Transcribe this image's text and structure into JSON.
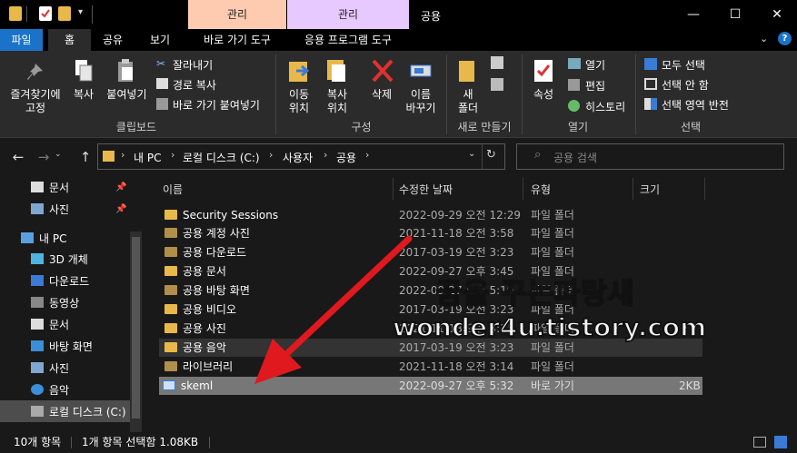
{
  "window": {
    "context_tab_1": "관리",
    "context_tab_2": "관리",
    "title": "공용",
    "ctx1_color": "#ffcbb0",
    "ctx2_color": "#e7c8ff"
  },
  "tabs": {
    "file": "파일",
    "home": "홈",
    "share": "공유",
    "view": "보기",
    "shortcut_tools": "바로 가기 도구",
    "app_tools": "응용 프로그램 도구"
  },
  "ribbon": {
    "pin": "즐겨찾기에\n고정",
    "copy": "복사",
    "paste": "붙여넣기",
    "cut": "잘라내기",
    "copy_path": "경로 복사",
    "paste_shortcut": "바로 가기 붙여넣기",
    "clipboard_group": "클립보드",
    "move_to": "이동\n위치",
    "copy_to": "복사\n위치",
    "delete": "삭제",
    "rename": "이름\n바꾸기",
    "organize_group": "구성",
    "new_folder": "새\n폴더",
    "new_group": "새로 만들기",
    "properties": "속성",
    "open": "열기",
    "edit": "편집",
    "history": "히스토리",
    "open_group": "열기",
    "select_all": "모두 선택",
    "select_none": "선택 안 함",
    "invert": "선택 영역 반전",
    "select_group": "선택"
  },
  "address": {
    "breadcrumb": [
      "내 PC",
      "로컬 디스크 (C:)",
      "사용자",
      "공용"
    ],
    "search_placeholder": "공용 검색"
  },
  "nav": {
    "items": [
      {
        "label": "문서",
        "icon": "documents-icon",
        "pin": true
      },
      {
        "label": "사진",
        "icon": "pictures-icon",
        "pin": true
      },
      {
        "label": "내 PC",
        "icon": "pc-icon"
      },
      {
        "label": "3D 개체",
        "icon": "3d-objects-icon"
      },
      {
        "label": "다운로드",
        "icon": "download-icon"
      },
      {
        "label": "동영상",
        "icon": "videos-icon"
      },
      {
        "label": "문서",
        "icon": "documents-icon"
      },
      {
        "label": "바탕 화면",
        "icon": "desktop-icon"
      },
      {
        "label": "사진",
        "icon": "pictures-icon"
      },
      {
        "label": "음악",
        "icon": "music-icon"
      },
      {
        "label": "로컬 디스크 (C:)",
        "icon": "drive-icon"
      }
    ]
  },
  "columns": {
    "name": "이름",
    "date": "수정한 날짜",
    "type": "유형",
    "size": "크기"
  },
  "files": [
    {
      "name": "Security Sessions",
      "date": "2022-09-29 오전 12:29",
      "type": "파일 폴더",
      "size": ""
    },
    {
      "name": "공용 계정 사진",
      "date": "2021-11-18 오전 3:58",
      "type": "파일 폴더",
      "size": ""
    },
    {
      "name": "공용 다운로드",
      "date": "2017-03-19 오전 3:23",
      "type": "파일 폴더",
      "size": ""
    },
    {
      "name": "공용 문서",
      "date": "2022-09-27 오후 3:45",
      "type": "파일 폴더",
      "size": ""
    },
    {
      "name": "공용 바탕 화면",
      "date": "2022-09-27 오후 5:19",
      "type": "파일 폴더",
      "size": ""
    },
    {
      "name": "공용 비디오",
      "date": "2017-03-19 오전 3:23",
      "type": "파일 폴더",
      "size": ""
    },
    {
      "name": "공용 사진",
      "date": "2021-11-18 오전 3:15",
      "type": "파일 폴더",
      "size": ""
    },
    {
      "name": "공용 음악",
      "date": "2017-03-19 오전 3:23",
      "type": "파일 폴더",
      "size": ""
    },
    {
      "name": "라이브러리",
      "date": "2021-11-18 오전 3:14",
      "type": "파일 폴더",
      "size": ""
    },
    {
      "name": "skeml",
      "date": "2022-09-27 오후 5:32",
      "type": "바로 가기",
      "size": "2KB"
    }
  ],
  "status": {
    "count": "10개 항목",
    "selected": "1개 항목 선택함 1.08KB"
  },
  "watermark": {
    "line1": "꿈을 꾸는파랑새",
    "line2": "wonder4u.tistory.com"
  }
}
